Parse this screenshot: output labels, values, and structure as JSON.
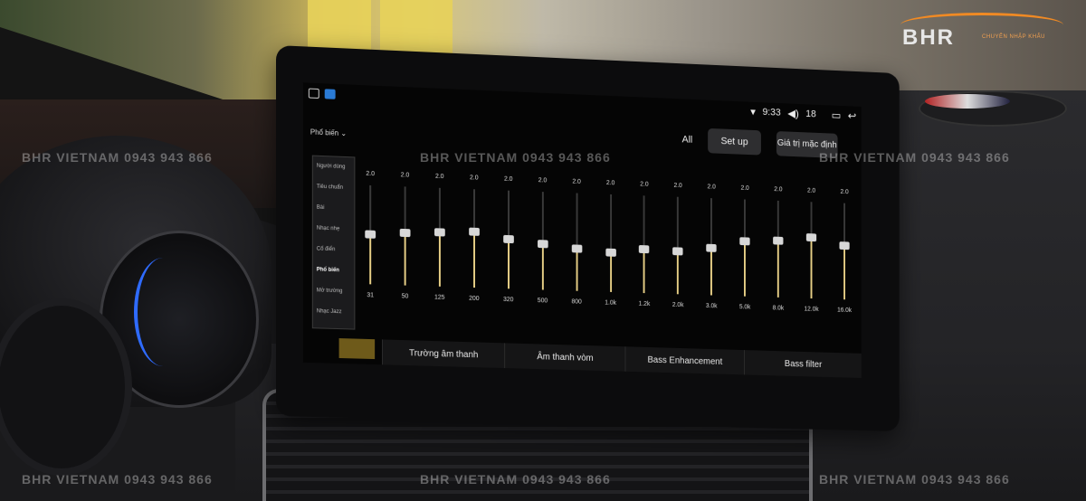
{
  "brand": {
    "logo": "BHR",
    "tagline": "CHUYÊN NHẬP KHẨU",
    "accent_color": "#f08a24"
  },
  "watermark": "BHR VIETNAM  0943 943 866",
  "status": {
    "wifi_icon": "wifi-icon",
    "time": "9:33",
    "volume_icon": "volume-icon",
    "volume": "18",
    "window_icon": "window-icon",
    "back_icon": "back-icon"
  },
  "toolbar": {
    "preset_dropdown": "Phổ biến",
    "all": "All",
    "setup": "Set up",
    "default": "Giá trị mặc định"
  },
  "presets": [
    "Người dùng",
    "Tiêu chuẩn",
    "Bài",
    "Nhạc nhẹ",
    "Cổ điển",
    "Phổ biến",
    "Mở trường",
    "Nhạc Jazz"
  ],
  "selected_preset": "Phổ biến",
  "eq_bands": [
    {
      "freq": "31",
      "value": "2.0",
      "level": 0.4
    },
    {
      "freq": "50",
      "value": "2.0",
      "level": 0.42
    },
    {
      "freq": "125",
      "value": "2.0",
      "level": 0.44
    },
    {
      "freq": "200",
      "value": "2.0",
      "level": 0.46
    },
    {
      "freq": "320",
      "value": "2.0",
      "level": 0.4
    },
    {
      "freq": "500",
      "value": "2.0",
      "level": 0.36
    },
    {
      "freq": "800",
      "value": "2.0",
      "level": 0.32
    },
    {
      "freq": "1.0k",
      "value": "2.0",
      "level": 0.3
    },
    {
      "freq": "1.2k",
      "value": "2.0",
      "level": 0.34
    },
    {
      "freq": "2.0k",
      "value": "2.0",
      "level": 0.33
    },
    {
      "freq": "3.0k",
      "value": "2.0",
      "level": 0.38
    },
    {
      "freq": "5.0k",
      "value": "2.0",
      "level": 0.46
    },
    {
      "freq": "8.0k",
      "value": "2.0",
      "level": 0.48
    },
    {
      "freq": "12.0k",
      "value": "2.0",
      "level": 0.52
    },
    {
      "freq": "16.0k",
      "value": "2.0",
      "level": 0.45
    }
  ],
  "tabs": [
    "Trường âm thanh",
    "Âm thanh vòm",
    "Bass Enhancement",
    "Bass filter"
  ]
}
